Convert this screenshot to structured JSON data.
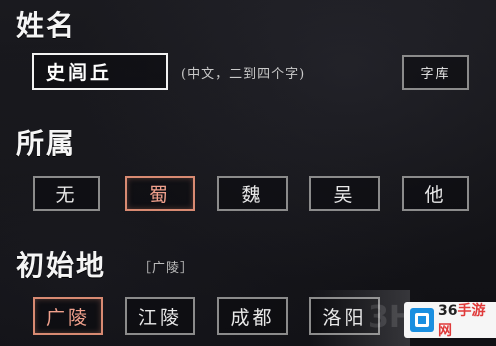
{
  "name_section": {
    "title": "姓名",
    "input_value": "史闾丘",
    "hint": "(中文，二到四个字)",
    "library_button": "字库"
  },
  "faction_section": {
    "title": "所属",
    "options": [
      {
        "label": "无",
        "selected": false
      },
      {
        "label": "蜀",
        "selected": true
      },
      {
        "label": "魏",
        "selected": false
      },
      {
        "label": "吴",
        "selected": false
      },
      {
        "label": "他",
        "selected": false
      }
    ]
  },
  "origin_section": {
    "title": "初始地",
    "current_tag": "［广陵］",
    "options": [
      {
        "label": "广陵",
        "selected": true
      },
      {
        "label": "江陵",
        "selected": false
      },
      {
        "label": "成都",
        "selected": false
      },
      {
        "label": "洛阳",
        "selected": false
      }
    ]
  },
  "watermark": {
    "text_num": "36",
    "text_main": "手游网",
    "ghost": "3H"
  },
  "colors": {
    "selected_border": "#d88a72",
    "normal_border": "#8b8b8b",
    "input_border": "#f2f2f2",
    "background": "#141418"
  }
}
